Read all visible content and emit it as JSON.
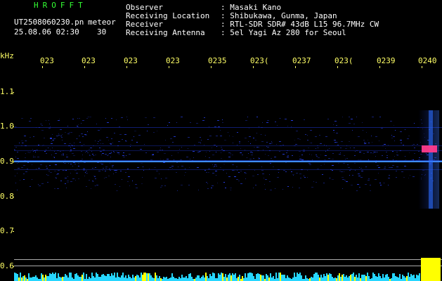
{
  "header": {
    "brand": "HROFFT",
    "filename": "UT2508060230.pn",
    "mode": "meteor",
    "datetime": "25.08.06 02:30",
    "count": "30",
    "info_labels": [
      "Observer",
      "Receiving Location",
      "Receiver",
      "Receiving Antenna"
    ],
    "info_values": [
      ": Masaki Kano",
      ": Shibukawa, Gunma, Japan",
      ": RTL-SDR SDR# 43dB L15 96.7MHz CW",
      ": 5el Yagi Az 280 for Seoul"
    ]
  },
  "axis": {
    "y_unit": "kHz",
    "y_ticks": [
      "1.1",
      "1.0",
      "0.9",
      "0.8",
      "0.7",
      "0.6"
    ],
    "x_ticks": [
      "023",
      "023",
      "023",
      "023",
      "0235",
      "023(",
      "0237",
      "023(",
      "0239",
      "0240"
    ]
  },
  "colors": {
    "header_brand": "#33ff33",
    "axis_text": "#ffff66",
    "carrier_line": "#3f8cff",
    "echo_highlight": "#ff3b8b",
    "bottom_bar_cyan": "#26d6ff",
    "bottom_bar_yellow": "#ffff00"
  }
}
